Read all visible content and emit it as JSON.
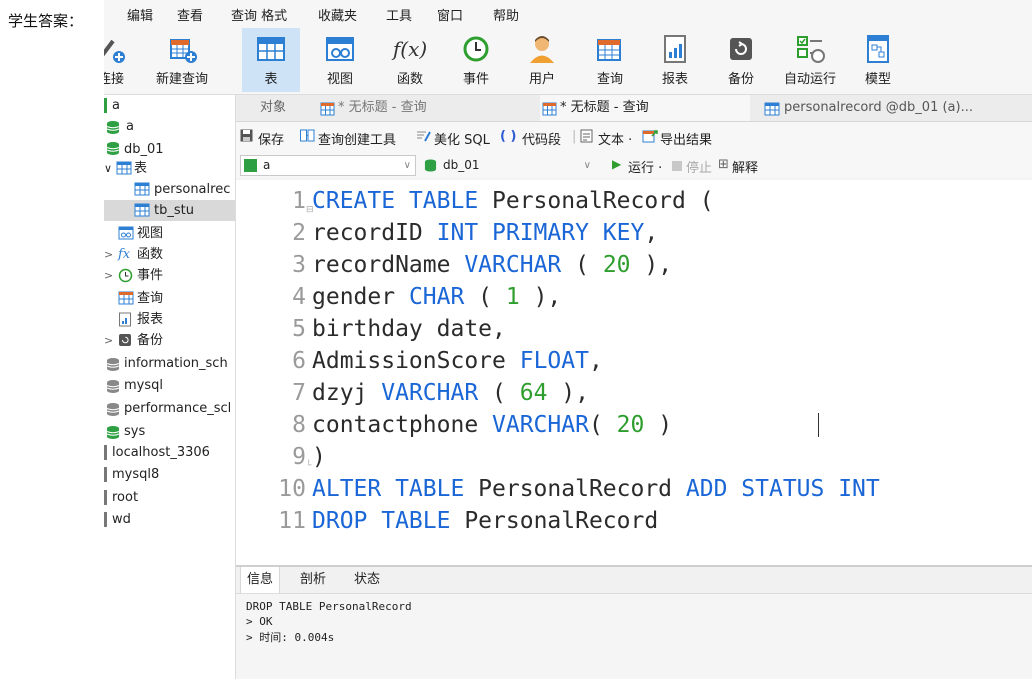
{
  "prefix_label": "学生答案：",
  "menu": [
    "编辑",
    "查看",
    "查询 格式",
    "收藏夹",
    "工具",
    "窗口",
    "帮助"
  ],
  "toolbar": [
    {
      "label": "连接",
      "icon": "connect-icon"
    },
    {
      "label": "新建查询",
      "icon": "new-query-icon"
    },
    {
      "label": "表",
      "icon": "table-icon",
      "active": true
    },
    {
      "label": "视图",
      "icon": "view-icon"
    },
    {
      "label": "函数",
      "icon": "function-icon",
      "glyph": "f(x)"
    },
    {
      "label": "事件",
      "icon": "event-clock-icon"
    },
    {
      "label": "用户",
      "icon": "user-icon"
    },
    {
      "label": "查询",
      "icon": "query-icon"
    },
    {
      "label": "报表",
      "icon": "report-icon"
    },
    {
      "label": "备份",
      "icon": "backup-icon"
    },
    {
      "label": "自动运行",
      "icon": "autorun-icon"
    },
    {
      "label": "模型",
      "icon": "model-icon"
    }
  ],
  "sidebar": {
    "items": [
      {
        "label": "a",
        "icon": "bar-green",
        "level": 0
      },
      {
        "label": "a",
        "icon": "db-green",
        "level": 0
      },
      {
        "label": "db_01",
        "icon": "db-green",
        "level": 0
      },
      {
        "label": "表",
        "icon": "table-icon",
        "level": 1,
        "arrow": "∨"
      },
      {
        "label": "personalrec",
        "icon": "table-icon",
        "level": 2
      },
      {
        "label": "tb_stu",
        "icon": "table-icon",
        "level": 2,
        "selected": true
      },
      {
        "label": "视图",
        "icon": "view-icon",
        "level": 1
      },
      {
        "label": "函数",
        "icon": "function-icon",
        "level": 1,
        "arrow": ">",
        "glyph": "fx"
      },
      {
        "label": "事件",
        "icon": "event-clock-icon",
        "level": 1,
        "arrow": ">"
      },
      {
        "label": "查询",
        "icon": "query-icon",
        "level": 1
      },
      {
        "label": "报表",
        "icon": "report-icon",
        "level": 1
      },
      {
        "label": "备份",
        "icon": "backup-icon",
        "level": 1,
        "arrow": ">"
      },
      {
        "label": "information_sch",
        "icon": "db-gray",
        "level": 0
      },
      {
        "label": "mysql",
        "icon": "db-gray",
        "level": 0
      },
      {
        "label": "performance_scl",
        "icon": "db-gray",
        "level": 0
      },
      {
        "label": "sys",
        "icon": "db-green",
        "level": 0
      },
      {
        "label": "localhost_3306",
        "icon": "bar-gray",
        "level": 0
      },
      {
        "label": "mysql8",
        "icon": "bar-gray",
        "level": 0
      },
      {
        "label": "root",
        "icon": "bar-gray",
        "level": 0
      },
      {
        "label": "wd",
        "icon": "bar-gray",
        "level": 0
      }
    ]
  },
  "tabs": [
    {
      "label": "对象",
      "icon": ""
    },
    {
      "label": "* 无标题 - 查询",
      "icon": "query-icon"
    },
    {
      "label": "* 无标题 - 查询",
      "icon": "query-icon",
      "active": true
    },
    {
      "label": "personalrecord @db_01 (a)...",
      "icon": "table-icon"
    }
  ],
  "query_toolbar": {
    "save": "保存",
    "builder": "查询创建工具",
    "beautify": "美化 SQL",
    "snippet": "代码段",
    "text": "文本 ·",
    "export": "导出结果"
  },
  "context": {
    "connection": "a",
    "database": "db_01",
    "run": "运行 ·",
    "stop": "停止",
    "explain": "解释"
  },
  "editor": {
    "lines": [
      [
        {
          "t": "CREATE TABLE ",
          "c": "kw"
        },
        {
          "t": "PersonalRecord (",
          "c": "txt"
        }
      ],
      [
        {
          "t": "recordID ",
          "c": "txt"
        },
        {
          "t": "INT PRIMARY KEY",
          "c": "kw"
        },
        {
          "t": ",",
          "c": "txt"
        }
      ],
      [
        {
          "t": "recordName ",
          "c": "txt"
        },
        {
          "t": "VARCHAR",
          "c": "kw"
        },
        {
          "t": " ( ",
          "c": "txt"
        },
        {
          "t": "20",
          "c": "num"
        },
        {
          "t": " ),",
          "c": "txt"
        }
      ],
      [
        {
          "t": "gender ",
          "c": "txt"
        },
        {
          "t": "CHAR",
          "c": "kw"
        },
        {
          "t": " ( ",
          "c": "txt"
        },
        {
          "t": "1",
          "c": "num"
        },
        {
          "t": " ),",
          "c": "txt"
        }
      ],
      [
        {
          "t": "birthday date,",
          "c": "txt"
        }
      ],
      [
        {
          "t": "AdmissionScore ",
          "c": "txt"
        },
        {
          "t": "FLOAT",
          "c": "kw"
        },
        {
          "t": ",",
          "c": "txt"
        }
      ],
      [
        {
          "t": "dzyj ",
          "c": "txt"
        },
        {
          "t": "VARCHAR",
          "c": "kw"
        },
        {
          "t": " ( ",
          "c": "txt"
        },
        {
          "t": "64",
          "c": "num"
        },
        {
          "t": " ),",
          "c": "txt"
        }
      ],
      [
        {
          "t": "contactphone ",
          "c": "txt"
        },
        {
          "t": "VARCHAR",
          "c": "kw"
        },
        {
          "t": "( ",
          "c": "txt"
        },
        {
          "t": "20",
          "c": "num"
        },
        {
          "t": " )",
          "c": "txt"
        }
      ],
      [
        {
          "t": ")",
          "c": "txt"
        }
      ],
      [
        {
          "t": "ALTER TABLE ",
          "c": "kw"
        },
        {
          "t": "PersonalRecord ",
          "c": "txt"
        },
        {
          "t": "ADD STATUS INT",
          "c": "kw"
        }
      ],
      [
        {
          "t": "DROP TABLE ",
          "c": "kw"
        },
        {
          "t": "PersonalRecord",
          "c": "txt"
        }
      ]
    ]
  },
  "info_tabs": [
    "信息",
    "剖析",
    "状态"
  ],
  "info_lines": [
    "DROP TABLE PersonalRecord",
    "> OK",
    "> 时间: 0.004s"
  ],
  "colors": {
    "keyword": "#1a66d6",
    "number": "#2e9e2e",
    "db_green": "#2ea043",
    "accent": "#2d7fd3"
  }
}
